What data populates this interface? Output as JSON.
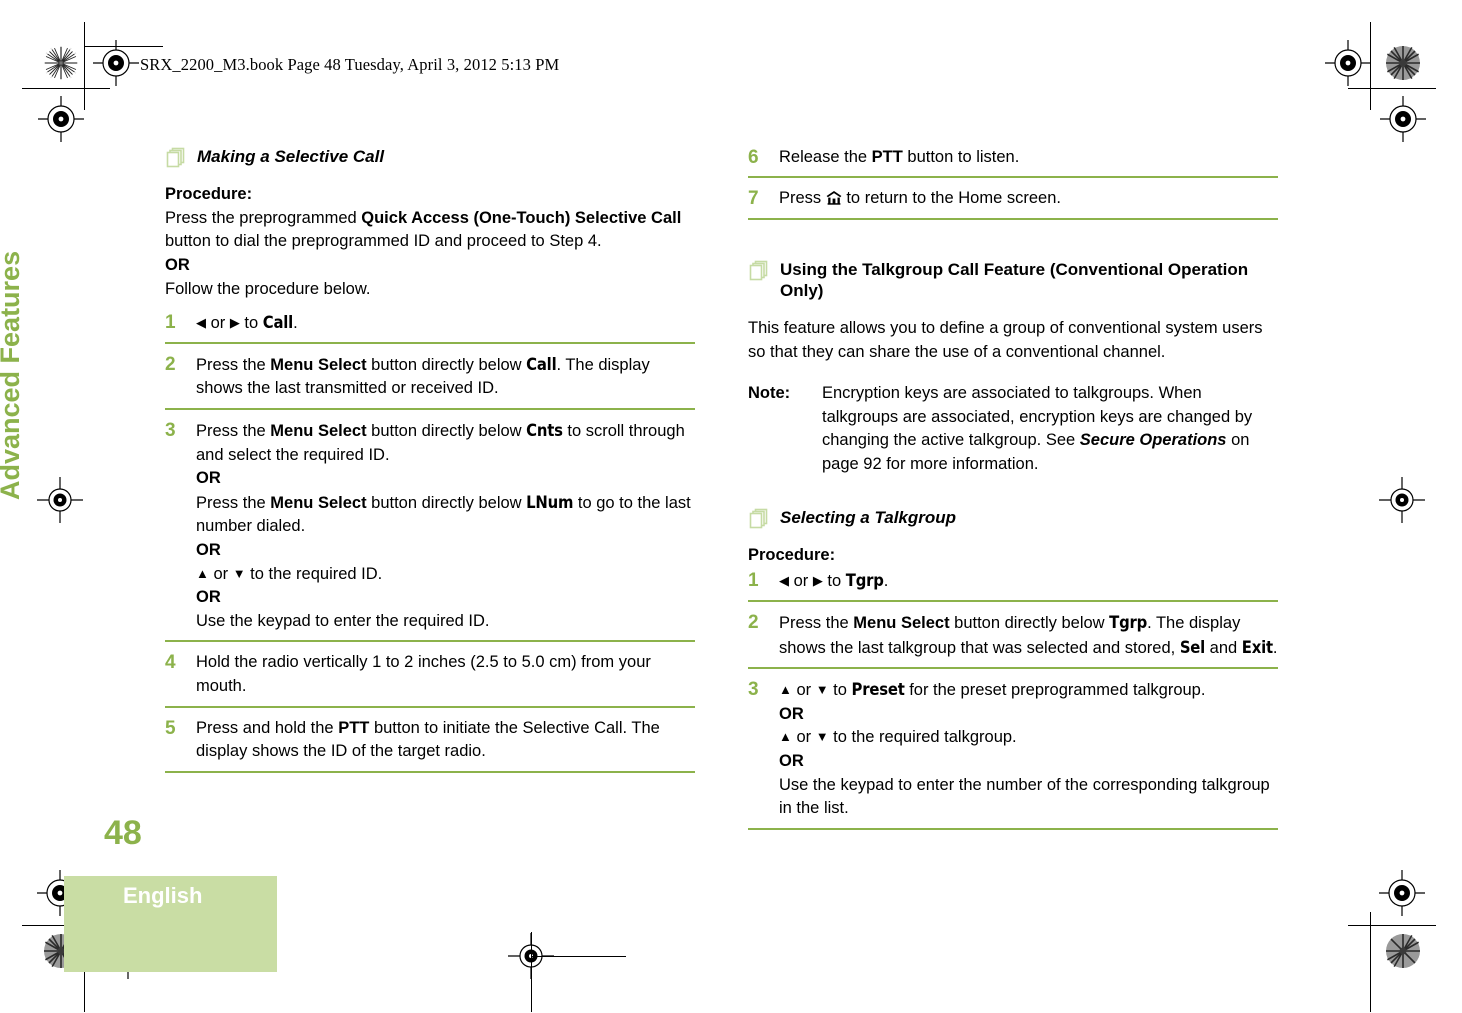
{
  "document": {
    "header": "SRX_2200_M3.book  Page 48  Tuesday, April 3, 2012  5:13 PM",
    "side_tab": "Advanced Features",
    "page_number": "48",
    "language": "English"
  },
  "colors": {
    "accent_green": "#8cb24b",
    "block_green": "#c9dda4",
    "icon_green": "#c6dba4"
  },
  "left_column": {
    "heading": "Making a Selective Call",
    "procedure_label": "Procedure:",
    "intro_1a": "Press the preprogrammed ",
    "intro_1b": "Quick Access (One-Touch) Selective Call",
    "intro_1c": " button to dial the preprogrammed ID and proceed to Step 4.",
    "or": "OR",
    "intro_2": "Follow the procedure below.",
    "steps": [
      {
        "num": "1",
        "p1": "",
        "left_arrow": "◀",
        "mid": " or ",
        "right_arrow": "▶",
        "p2": " to ",
        "term": "Call",
        "p3": "."
      },
      {
        "num": "2",
        "p1": "Press the ",
        "b1": "Menu Select",
        "p2": " button directly below ",
        "term": "Call",
        "p3": ". The display shows the last transmitted or received ID."
      },
      {
        "num": "3",
        "a_p1": "Press the ",
        "a_b1": "Menu Select",
        "a_p2": " button directly below ",
        "a_term": "Cnts",
        "a_p3": " to scroll through and select the required ID.",
        "or1": "OR",
        "b_p1": "Press the ",
        "b_b1": "Menu Select",
        "b_p2": " button directly below ",
        "b_term": "LNum",
        "b_p3": " to go to the last number dialed.",
        "or2": "OR",
        "c_up": "▲",
        "c_mid": " or ",
        "c_down": "▼",
        "c_p1": " to the required ID.",
        "or3": "OR",
        "d_p1": "Use the keypad to enter the required ID."
      },
      {
        "num": "4",
        "p1": "Hold the radio vertically 1 to 2 inches (2.5 to 5.0 cm) from your mouth."
      },
      {
        "num": "5",
        "p1": "Press and hold the ",
        "b1": "PTT",
        "p2": " button to initiate the Selective Call. The display shows the ID of the target radio."
      }
    ]
  },
  "right_column": {
    "steps_continued": [
      {
        "num": "6",
        "p1": "Release the ",
        "b1": "PTT",
        "p2": " button to listen."
      },
      {
        "num": "7",
        "p1": "Press ",
        "icon": "home-icon",
        "p2": " to return to the Home screen."
      }
    ],
    "heading_talkgroup": "Using the Talkgroup Call Feature (Conventional Operation Only)",
    "intro": "This feature allows you to define a group of conventional system users so that they can share the use of a conventional channel.",
    "note": {
      "label": "Note:",
      "p1": "Encryption keys are associated to talkgroups. When talkgroups are associated, encryption keys are changed by changing the active talkgroup. See ",
      "bi": "Secure Operations",
      "p2": " on page 92 for more information."
    },
    "heading_selecting": "Selecting a Talkgroup",
    "procedure_label": "Procedure:",
    "steps": [
      {
        "num": "1",
        "left_arrow": "◀",
        "mid": " or ",
        "right_arrow": "▶",
        "p2": " to ",
        "term": "Tgrp",
        "p3": "."
      },
      {
        "num": "2",
        "p1": "Press the ",
        "b1": "Menu Select",
        "p2": " button directly below ",
        "term": "Tgrp",
        "p3": ". The display shows the last talkgroup that was selected and stored, ",
        "term2": "Sel",
        "p4": " and ",
        "term3": "Exit",
        "p5": "."
      },
      {
        "num": "3",
        "a_up": "▲",
        "a_mid": " or ",
        "a_down": "▼",
        "a_p1": " to ",
        "a_term": "Preset",
        "a_p2": " for the preset preprogrammed talkgroup.",
        "or1": "OR",
        "b_up": "▲",
        "b_mid": " or ",
        "b_down": "▼",
        "b_p1": " to the required talkgroup.",
        "or2": "OR",
        "c_p1": "Use the keypad to enter the number of the corresponding talkgroup in the list."
      }
    ]
  }
}
